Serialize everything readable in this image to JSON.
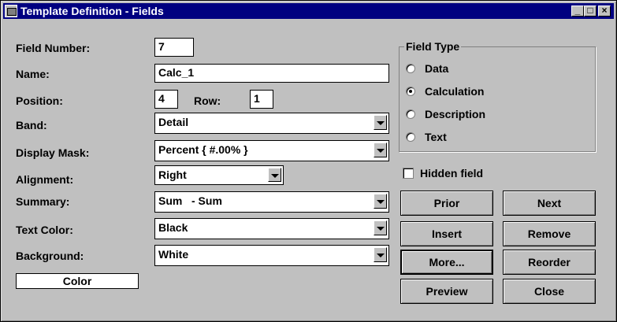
{
  "window": {
    "title": "Template Definition - Fields",
    "minimize": "_",
    "maximize": "□",
    "close": "×"
  },
  "labels": {
    "field_number": "Field Number:",
    "name": "Name:",
    "position": "Position:",
    "row": "Row:",
    "band": "Band:",
    "display_mask": "Display Mask:",
    "alignment": "Alignment:",
    "summary": "Summary:",
    "text_color": "Text Color:",
    "background": "Background:"
  },
  "values": {
    "field_number": "7",
    "name": "Calc_1",
    "position": "4",
    "row": "1",
    "band": "Detail",
    "display_mask": "Percent { #.00% }",
    "alignment": "Right",
    "summary": "Sum   - Sum",
    "text_color": "Black",
    "background": "White"
  },
  "color_button": "Color",
  "field_type": {
    "label": "Field Type",
    "options": [
      "Data",
      "Calculation",
      "Description",
      "Text"
    ],
    "selected": "Calculation"
  },
  "hidden_field": {
    "label": "Hidden field",
    "checked": false
  },
  "buttons": {
    "prior": "Prior",
    "next": "Next",
    "insert": "Insert",
    "remove": "Remove",
    "more": "More...",
    "reorder": "Reorder",
    "preview": "Preview",
    "close": "Close"
  },
  "colors": {
    "title_bar": "#000080",
    "face": "#c0c0c0"
  }
}
